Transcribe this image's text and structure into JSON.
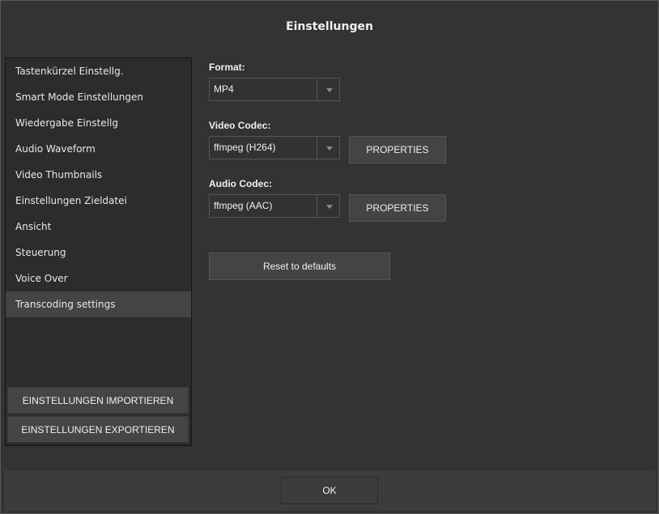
{
  "dialog": {
    "title": "Einstellungen"
  },
  "sidebar": {
    "items": [
      {
        "label": "Tastenkürzel Einstellg."
      },
      {
        "label": "Smart Mode Einstellungen"
      },
      {
        "label": "Wiedergabe Einstellg"
      },
      {
        "label": "Audio Waveform"
      },
      {
        "label": "Video Thumbnails"
      },
      {
        "label": "Einstellungen Zieldatei"
      },
      {
        "label": "Ansicht"
      },
      {
        "label": "Steuerung"
      },
      {
        "label": "Voice Over"
      },
      {
        "label": "Transcoding settings"
      }
    ],
    "active_item": "Transcoding settings",
    "import_label": "EINSTELLUNGEN IMPORTIEREN",
    "export_label": "EINSTELLUNGEN EXPORTIEREN"
  },
  "transcoding": {
    "format_label": "Format:",
    "format_value": "MP4",
    "video_codec_label": "Video Codec:",
    "video_codec_value": "ffmpeg (H264)",
    "video_properties_label": "PROPERTIES",
    "audio_codec_label": "Audio Codec:",
    "audio_codec_value": "ffmpeg (AAC)",
    "audio_properties_label": "PROPERTIES",
    "reset_label": "Reset to defaults"
  },
  "footer": {
    "ok_label": "OK"
  },
  "icons": {
    "dropdown": "chevron-down-icon"
  },
  "colors": {
    "dialog_bg": "#333333",
    "sidebar_bg": "#2c2c2c",
    "active_item_bg": "#444444",
    "button_bg": "#444444",
    "footer_bg": "#3c3c3c",
    "text": "#f0f0f0"
  }
}
